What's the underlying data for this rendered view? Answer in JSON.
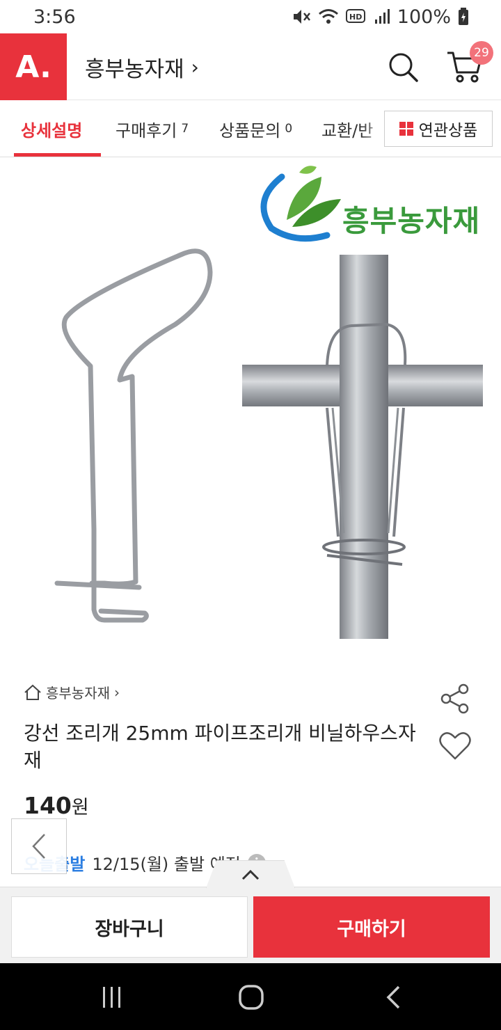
{
  "status_bar": {
    "time": "3:56",
    "battery": "100%"
  },
  "header": {
    "logo_text": "A.",
    "store_name": "흥부농자재",
    "store_chevron": "›",
    "cart_count": "29"
  },
  "tabs": [
    {
      "label": "상세설명",
      "count": ""
    },
    {
      "label": "구매후기",
      "count": "7"
    },
    {
      "label": "상품문의",
      "count": "0"
    },
    {
      "label": "교환/반",
      "count": ""
    }
  ],
  "related_button": "연관상품",
  "product_image": {
    "brand_text": "흥부농자재"
  },
  "product": {
    "breadcrumb": "흥부농자재",
    "breadcrumb_chevron": "›",
    "title": "강선 조리개 25mm 파이프조리개 비닐하우스자재",
    "price": "140",
    "price_unit": "원",
    "shipping_badge": "오늘출발",
    "shipping_text": "12/15(월) 출발 예정",
    "info_icon": "i"
  },
  "bottom_bar": {
    "cart_label": "장바구니",
    "buy_label": "구매하기"
  },
  "colors": {
    "accent": "#e8323c",
    "brand_green": "#3a9a3c",
    "shipping_blue": "#2a7de1"
  },
  "icons": [
    "mute-icon",
    "wifi-icon",
    "hd-icon",
    "signal-icon",
    "battery-icon",
    "search-icon",
    "cart-icon",
    "home-icon",
    "share-icon",
    "heart-icon",
    "info-icon",
    "chevron-left-icon",
    "chevron-up-icon",
    "recent-apps-icon",
    "home-nav-icon",
    "back-nav-icon"
  ]
}
